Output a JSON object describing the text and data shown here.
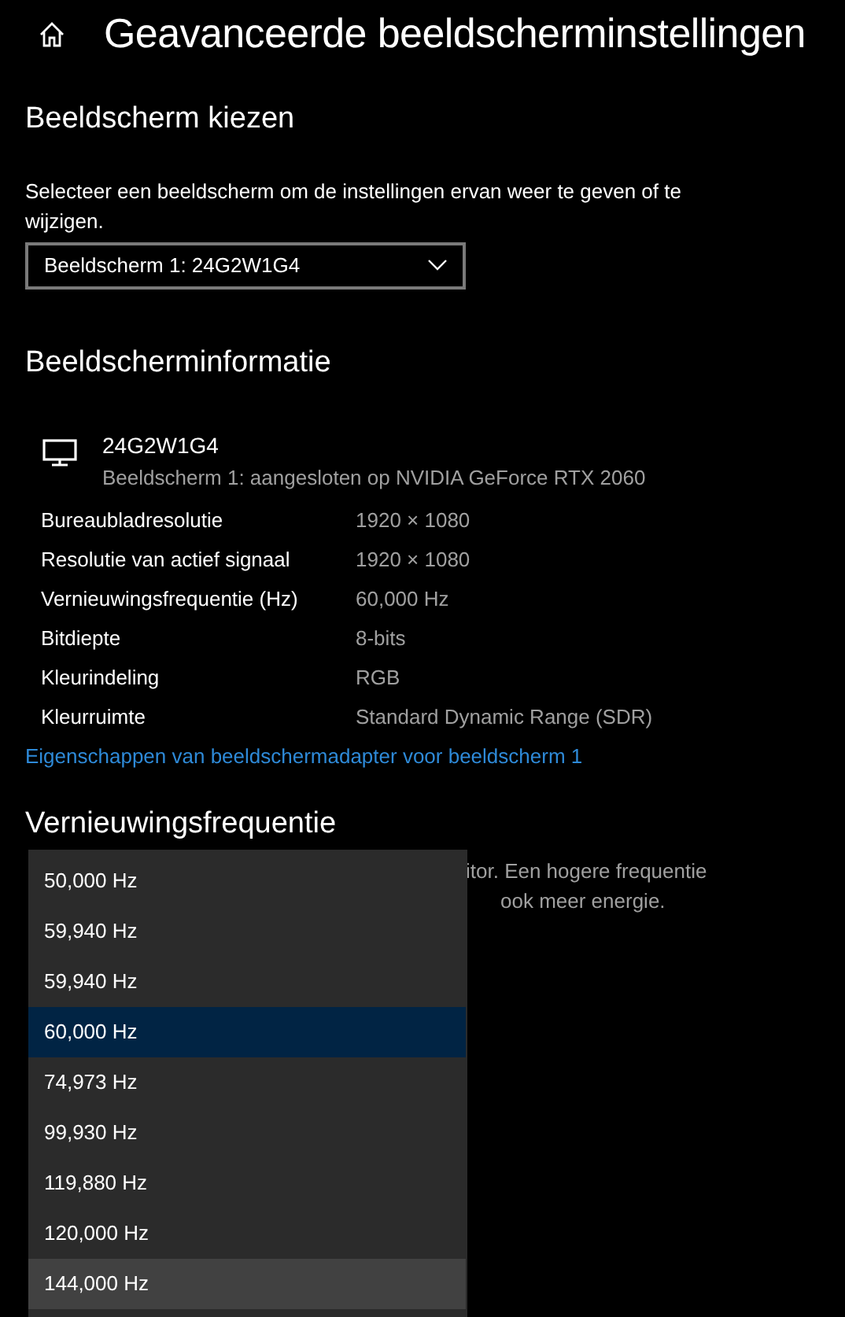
{
  "window": {
    "title": "Geavanceerde beeldscherminstellingen"
  },
  "choose_display": {
    "heading": "Beeldscherm kiezen",
    "description": "Selecteer een beeldscherm om de instellingen ervan weer te geven of te wijzigen.",
    "dropdown": {
      "value": "Beeldscherm 1: 24G2W1G4"
    }
  },
  "display_info": {
    "heading": "Beeldscherminformatie",
    "monitor_name": "24G2W1G4",
    "monitor_detail": "Beeldscherm 1: aangesloten op NVIDIA GeForce RTX 2060",
    "rows": [
      {
        "label": "Bureaubladresolutie",
        "value": "1920 × 1080"
      },
      {
        "label": "Resolutie van actief signaal",
        "value": "1920 × 1080"
      },
      {
        "label": "Vernieuwingsfrequentie (Hz)",
        "value": "60,000 Hz"
      },
      {
        "label": "Bitdiepte",
        "value": "8-bits"
      },
      {
        "label": "Kleurindeling",
        "value": "RGB"
      },
      {
        "label": "Kleurruimte",
        "value": "Standard Dynamic Range (SDR)"
      }
    ],
    "link": "Eigenschappen van beeldschermadapter voor beeldscherm 1"
  },
  "refresh_rate": {
    "heading": "Vernieuwingsfrequentie",
    "description_lines": [
      "itor. Een hogere frequentie",
      "ook meer energie."
    ],
    "options": [
      {
        "label": "50,000 Hz",
        "selected": false,
        "hovered": false
      },
      {
        "label": "59,940 Hz",
        "selected": false,
        "hovered": false
      },
      {
        "label": "59,940 Hz",
        "selected": false,
        "hovered": false
      },
      {
        "label": "60,000 Hz",
        "selected": true,
        "hovered": false
      },
      {
        "label": "74,973 Hz",
        "selected": false,
        "hovered": false
      },
      {
        "label": "99,930 Hz",
        "selected": false,
        "hovered": false
      },
      {
        "label": "119,880 Hz",
        "selected": false,
        "hovered": false
      },
      {
        "label": "120,000 Hz",
        "selected": false,
        "hovered": false
      },
      {
        "label": "144,000 Hz",
        "selected": false,
        "hovered": true
      }
    ]
  }
}
